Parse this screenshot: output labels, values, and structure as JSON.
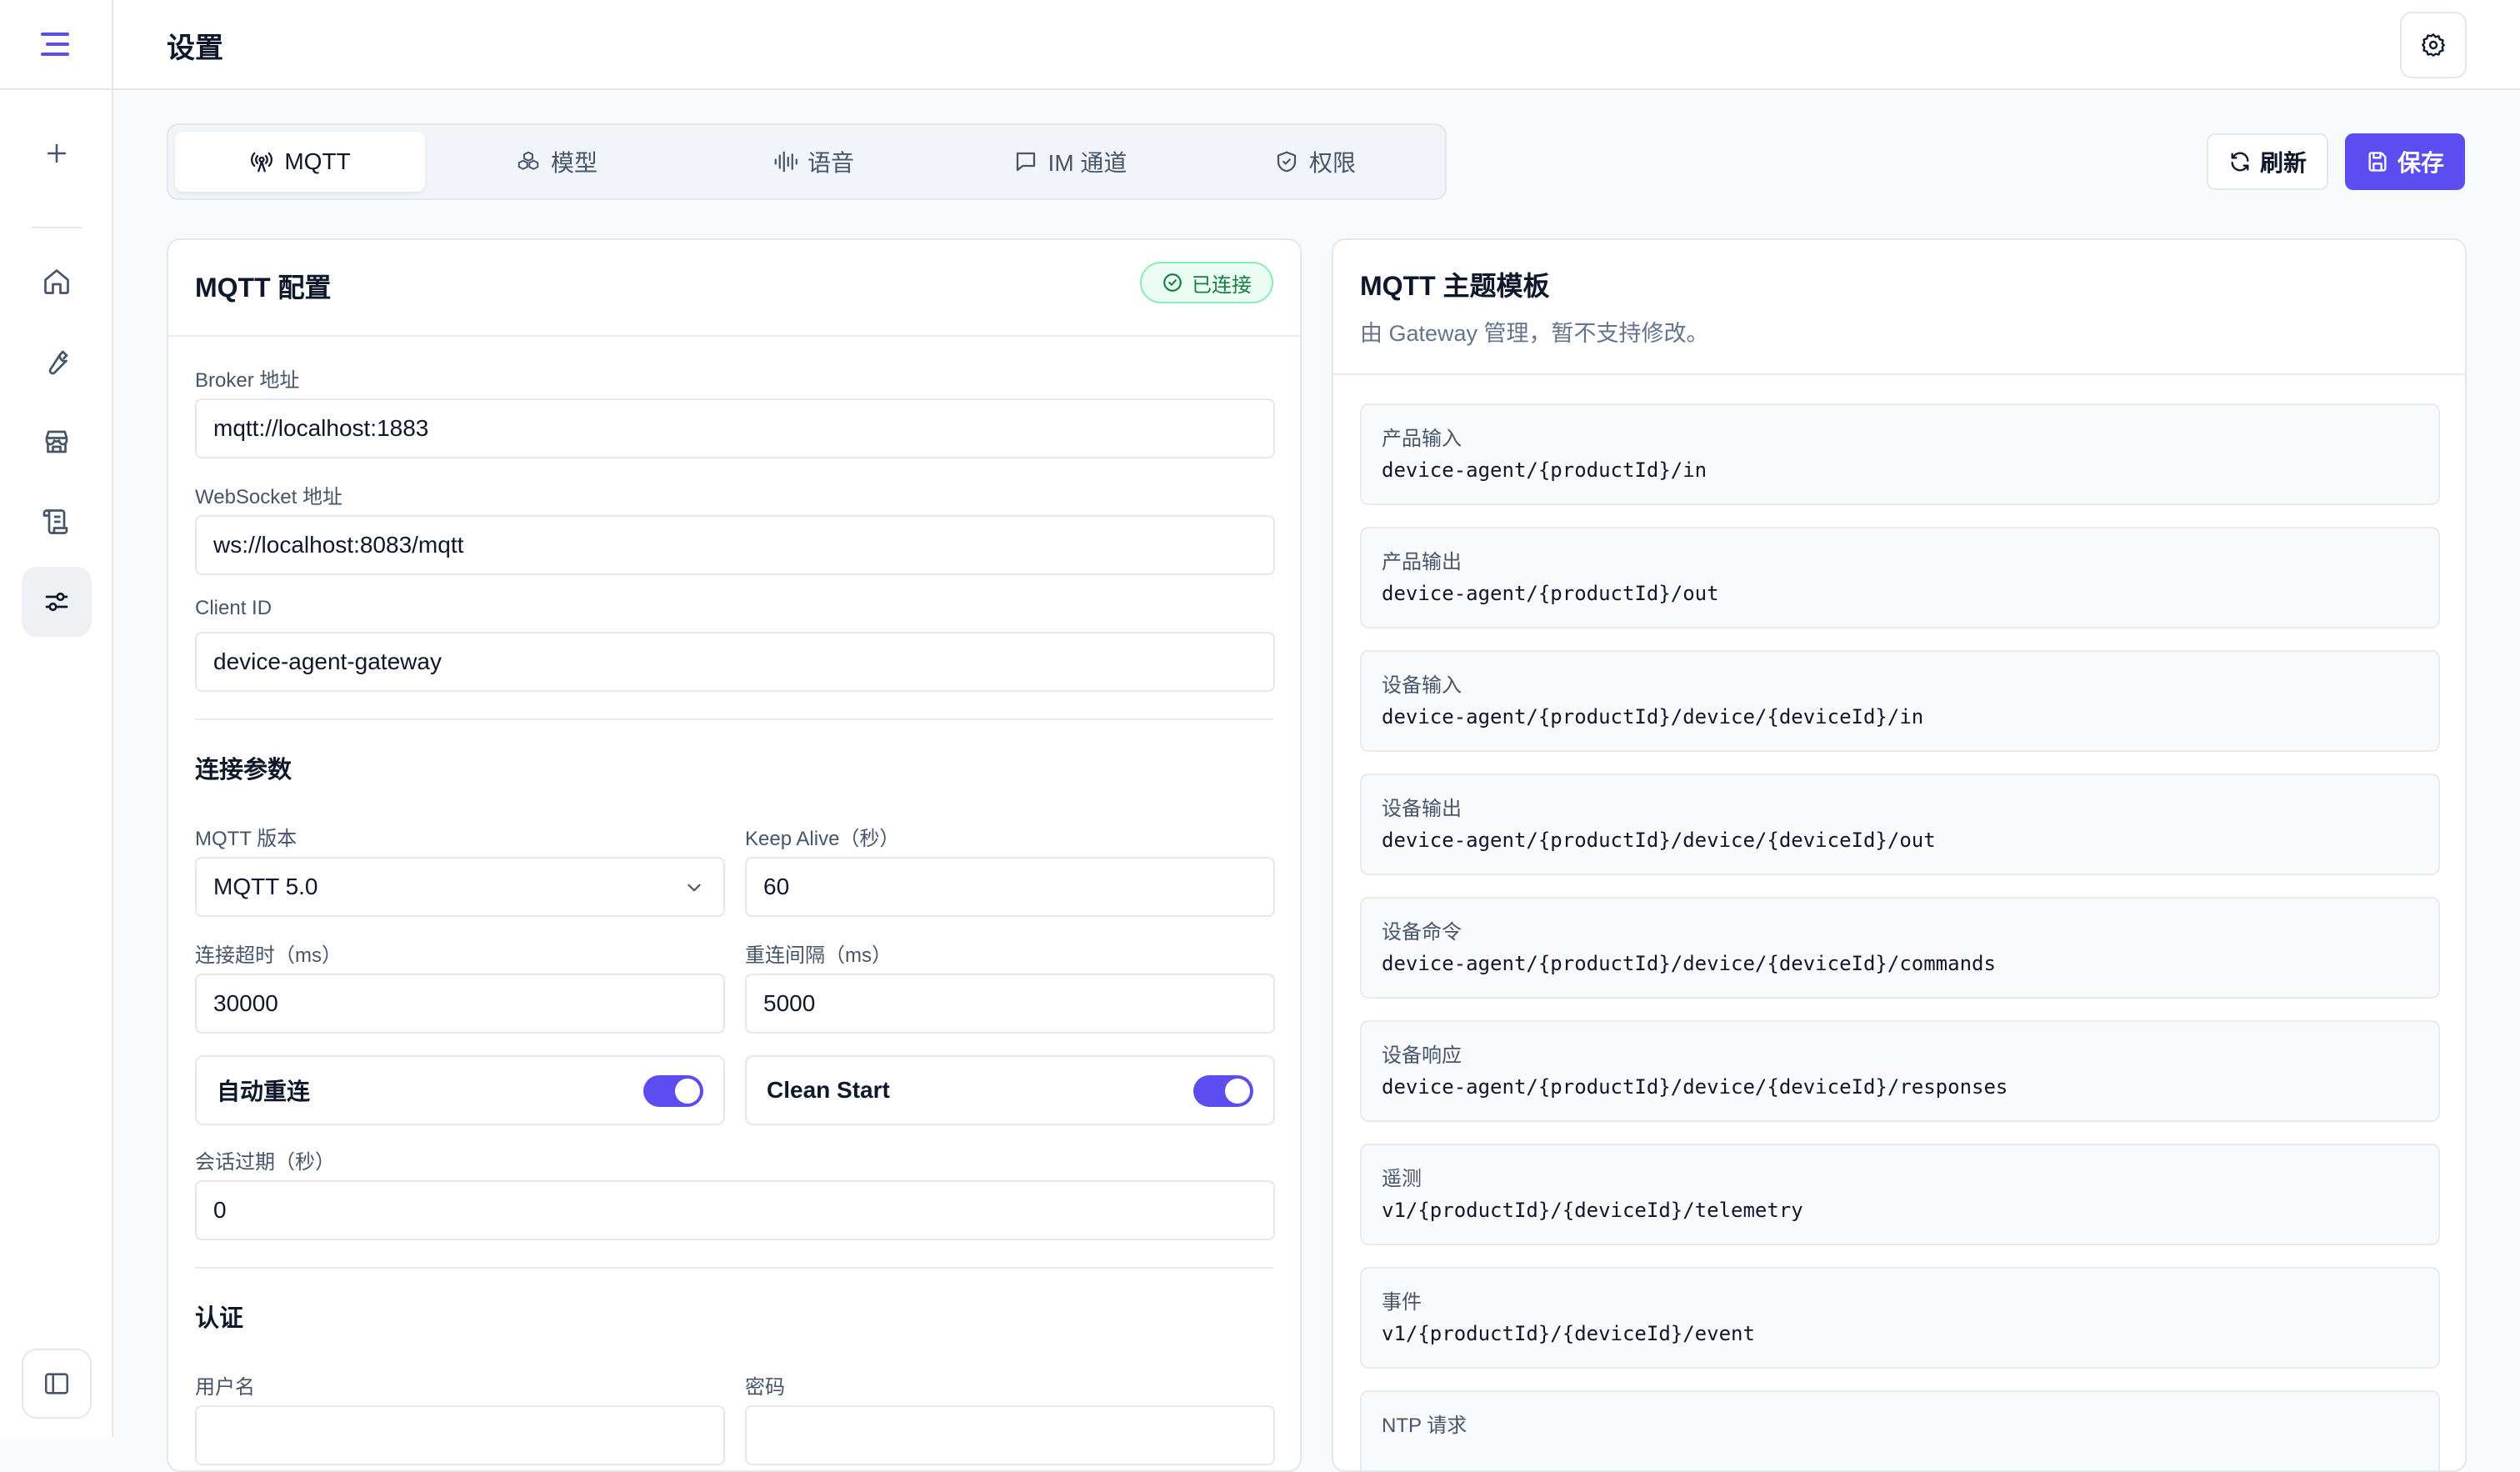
{
  "header": {
    "title": "设置"
  },
  "tabs": [
    {
      "label": "MQTT",
      "icon": "antenna-icon"
    },
    {
      "label": "模型",
      "icon": "boxes-icon"
    },
    {
      "label": "语音",
      "icon": "audio-wave-icon"
    },
    {
      "label": "IM 通道",
      "icon": "message-square-icon"
    },
    {
      "label": "权限",
      "icon": "shield-check-icon"
    }
  ],
  "actions": {
    "refresh": "刷新",
    "save": "保存"
  },
  "mqtt_config": {
    "title": "MQTT 配置",
    "status": "已连接",
    "broker_label": "Broker 地址",
    "broker_value": "mqtt://localhost:1883",
    "websocket_label": "WebSocket 地址",
    "websocket_value": "ws://localhost:8083/mqtt",
    "client_id_label": "Client ID",
    "client_id_value": "device-agent-gateway",
    "conn_section": "连接参数",
    "version_label": "MQTT 版本",
    "version_value": "MQTT 5.0",
    "keepalive_label": "Keep Alive（秒）",
    "keepalive_value": "60",
    "timeout_label": "连接超时（ms）",
    "timeout_value": "30000",
    "reconnect_label": "重连间隔（ms）",
    "reconnect_value": "5000",
    "auto_reconnect_label": "自动重连",
    "auto_reconnect_on": true,
    "clean_start_label": "Clean Start",
    "clean_start_on": true,
    "session_expiry_label": "会话过期（秒）",
    "session_expiry_value": "0",
    "auth_section": "认证",
    "username_label": "用户名",
    "password_label": "密码"
  },
  "topics": {
    "title": "MQTT 主题模板",
    "description": "由 Gateway 管理，暂不支持修改。",
    "items": [
      {
        "name": "产品输入",
        "value": "device-agent/{productId}/in"
      },
      {
        "name": "产品输出",
        "value": "device-agent/{productId}/out"
      },
      {
        "name": "设备输入",
        "value": "device-agent/{productId}/device/{deviceId}/in"
      },
      {
        "name": "设备输出",
        "value": "device-agent/{productId}/device/{deviceId}/out"
      },
      {
        "name": "设备命令",
        "value": "device-agent/{productId}/device/{deviceId}/commands"
      },
      {
        "name": "设备响应",
        "value": "device-agent/{productId}/device/{deviceId}/responses"
      },
      {
        "name": "遥测",
        "value": "v1/{productId}/{deviceId}/telemetry"
      },
      {
        "name": "事件",
        "value": "v1/{productId}/{deviceId}/event"
      },
      {
        "name": "NTP 请求",
        "value": ""
      }
    ]
  },
  "colors": {
    "accent": "#5b4df0",
    "success": "#15803d"
  }
}
